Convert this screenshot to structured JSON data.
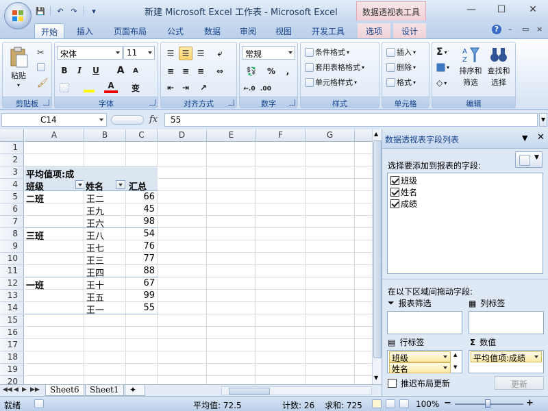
{
  "window": {
    "title": "新建 Microsoft Excel 工作表 - Microsoft Excel",
    "context_tab": "数据透视表工具",
    "controls": {
      "minimize": "—",
      "maximize": "☐",
      "close": "✕"
    }
  },
  "quick_access": {
    "save_icon": "💾",
    "undo_icon": "↶",
    "redo_icon": "↷",
    "customize_icon": "▾"
  },
  "tabs": [
    {
      "label": "开始"
    },
    {
      "label": "插入"
    },
    {
      "label": "页面布局"
    },
    {
      "label": "公式"
    },
    {
      "label": "数据"
    },
    {
      "label": "审阅"
    },
    {
      "label": "视图"
    },
    {
      "label": "开发工具"
    },
    {
      "label": "选项"
    },
    {
      "label": "设计"
    }
  ],
  "ribbon_controls": {
    "help": "?",
    "minimize": "–",
    "restore": "▭",
    "close": "×"
  },
  "ribbon": {
    "clipboard": {
      "label": "剪贴板",
      "paste": "粘贴"
    },
    "font": {
      "label": "字体",
      "name": "宋体",
      "size": "11",
      "bold": "B",
      "italic": "I",
      "underline": "U",
      "grow": "A",
      "shrink": "A",
      "fontcolor": "A",
      "phonetic": "变"
    },
    "alignment": {
      "label": "对齐方式"
    },
    "number": {
      "label": "数字",
      "format": "常规",
      "percent": "%",
      "comma": ","
    },
    "styles": {
      "label": "样式",
      "conditional": "条件格式",
      "table": "套用表格格式",
      "cell": "单元格样式"
    },
    "cells": {
      "label": "单元格",
      "insert": "插入",
      "delete": "删除",
      "format": "格式"
    },
    "editing": {
      "label": "编辑",
      "sum": "Σ",
      "sort": "排序和",
      "sort2": "筛选",
      "find": "查找和",
      "find2": "选择"
    }
  },
  "formula_bar": {
    "name_box": "C14",
    "fx": "fx",
    "value": "55"
  },
  "grid": {
    "columns": [
      "A",
      "B",
      "C",
      "D",
      "E",
      "F",
      "G"
    ],
    "rows": [
      "1",
      "2",
      "3",
      "4",
      "5",
      "6",
      "7",
      "8",
      "9",
      "10",
      "11",
      "12",
      "13",
      "14",
      "15",
      "16",
      "17",
      "18",
      "19",
      "20"
    ],
    "pivot": {
      "values_caption": "平均值项:成",
      "row_header": "班级",
      "col_name_header": "姓名",
      "total_header": "汇总",
      "groups": [
        {
          "class": "二班",
          "items": [
            {
              "name": "王二",
              "value": "66"
            },
            {
              "name": "王九",
              "value": "45"
            },
            {
              "name": "王六",
              "value": "98"
            }
          ]
        },
        {
          "class": "三班",
          "items": [
            {
              "name": "王八",
              "value": "54"
            },
            {
              "name": "王七",
              "value": "76"
            },
            {
              "name": "王三",
              "value": "77"
            },
            {
              "name": "王四",
              "value": "88"
            }
          ]
        },
        {
          "class": "一班",
          "items": [
            {
              "name": "王十",
              "value": "67"
            },
            {
              "name": "王五",
              "value": "99"
            },
            {
              "name": "王一",
              "value": "55"
            }
          ]
        }
      ]
    }
  },
  "sheets": {
    "nav": [
      "◀◀",
      "◀",
      "▶",
      "▶▶"
    ],
    "tabs": [
      "Sheet6",
      "Sheet1"
    ]
  },
  "pivot_pane": {
    "title": "数据透视表字段列表",
    "choose_label": "选择要添加到报表的字段:",
    "fields": [
      "班级",
      "姓名",
      "成绩"
    ],
    "drag_label": "在以下区域间拖动字段:",
    "filter_label": "报表筛选",
    "columns_label": "列标签",
    "rows_label": "行标签",
    "values_label": "数值",
    "row_fields": [
      "班级",
      "姓名"
    ],
    "value_fields": [
      "平均值项:成绩"
    ],
    "defer_label": "推迟布局更新",
    "update_button": "更新"
  },
  "status": {
    "ready": "就绪",
    "average": "平均值: 72.5",
    "count": "计数: 26",
    "sum": "求和: 725",
    "zoom": "100%",
    "zoom_out": "−",
    "zoom_in": "+"
  }
}
